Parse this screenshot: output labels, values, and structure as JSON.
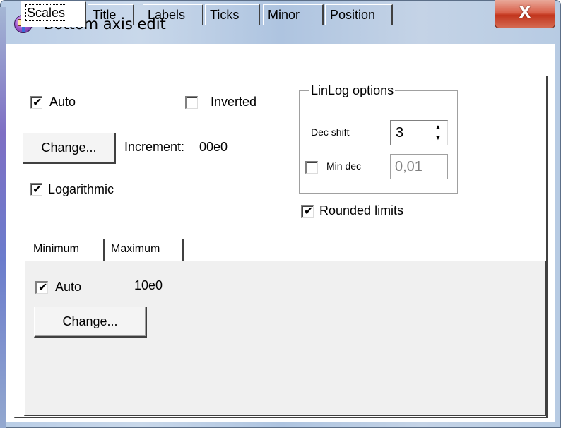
{
  "window": {
    "title": "Bottom axis edit",
    "close_label": "X",
    "app_icon": "teechart-app-icon"
  },
  "tabs": [
    {
      "label": "Scales",
      "active": true
    },
    {
      "label": "Title",
      "active": false
    },
    {
      "label": "Labels",
      "active": false
    },
    {
      "label": "Ticks",
      "active": false
    },
    {
      "label": "Minor",
      "active": false
    },
    {
      "label": "Position",
      "active": false
    }
  ],
  "scales": {
    "auto": {
      "label": "Auto",
      "checked": true
    },
    "inverted": {
      "label": "Inverted",
      "checked": false
    },
    "change_button": "Change...",
    "increment_label": "Increment:",
    "increment_value": "00e0",
    "logarithmic": {
      "label": "Logarithmic",
      "checked": true
    },
    "rounded_limits": {
      "label": "Rounded limits",
      "checked": true
    }
  },
  "linlog": {
    "title": "LinLog options",
    "dec_shift_label": "Dec shift",
    "dec_shift_value": "3",
    "min_dec": {
      "label": "Min dec",
      "checked": false
    },
    "min_dec_value": "0,01"
  },
  "inner_tabs": [
    {
      "label": "Minimum",
      "active": true
    },
    {
      "label": "Maximum",
      "active": false
    }
  ],
  "minimum": {
    "auto_label": "Auto",
    "auto_checked": true,
    "value": "10e0",
    "change_button": "Change..."
  },
  "colors": {
    "window_bg": "#ffffff",
    "close_red": "#c2351d",
    "inner_page_bg": "#f0f0f0"
  }
}
